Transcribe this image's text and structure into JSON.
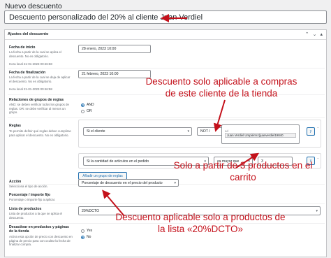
{
  "page": {
    "title": "Nuevo descuento"
  },
  "discount_title": "Descuento personalizado del 20% al cliente Juan Verdiel",
  "panel": {
    "title": "Ajustes del descuento"
  },
  "start": {
    "label": "Fecha de inicio",
    "desc": "La fecha a partir de la cual se aplica el descuento. No es obligatorio.",
    "value": "28 enero, 2023 10:00",
    "local": "Hora local 21-01-2023 00:46:58"
  },
  "end": {
    "label": "Fecha de finalización",
    "desc": "La fecha a partir de la cual se deja de aplicar el descuento. No es obligatorio.",
    "value": "21 febrero, 2023 10:00",
    "local": "Hora local 21-01-2023 00:46:58"
  },
  "rule_groups": {
    "label": "Relaciones de grupos de reglas",
    "desc": "AND: se deben verificar todos los grupos de reglas. OR: se debe verificar al menos un grupo.",
    "options": [
      "AND",
      "OR"
    ]
  },
  "rules": {
    "label": "Reglas",
    "desc": "Te permite definir qué reglas deben cumplirse para aplicar el descuento. No es obligatorio.",
    "rule1": {
      "condition": "Si el cliente",
      "operator": "NOT /",
      "users_prefix": "ad",
      "user": "Juan Verdiel Umpiérrez(juanverdiel19840",
      "and": "y"
    },
    "rule2": {
      "condition": "Si la cantidad de artículos en el pedido",
      "operator": "es mayor que",
      "value": "3",
      "and": "y"
    },
    "add_group": "Añadir un grupo de reglas"
  },
  "action": {
    "label": "Acción",
    "desc": "Selecciona el tipo de acción.",
    "value": "Porcentaje de descuento en el precio del producto"
  },
  "percent": {
    "label": "Porcentaje / importe fijo",
    "desc": "Porcentaje o importe fijo a aplicar."
  },
  "products": {
    "label": "Lista de productos",
    "desc": "Lista de productos a la que se aplica el descuento.",
    "value": "20%DCTO"
  },
  "deactivate": {
    "label": "Desactivar en productos y páginas de la tienda",
    "desc": "Activa esta opción de precio con descuento en página de precio para con ocultar la fecha de finalizar compra.",
    "options": [
      "Yes",
      "No"
    ]
  },
  "annotations": {
    "a1": "Descuento solo aplicable a compras de este cliente de la tienda",
    "a2": "Solo a partir de 3 productos en el carrito",
    "a3": "Descuento aplicable solo a productos de la lista «20%DCTO»"
  },
  "colors": {
    "annotation": "#c4111b",
    "accent": "#2271b1"
  }
}
